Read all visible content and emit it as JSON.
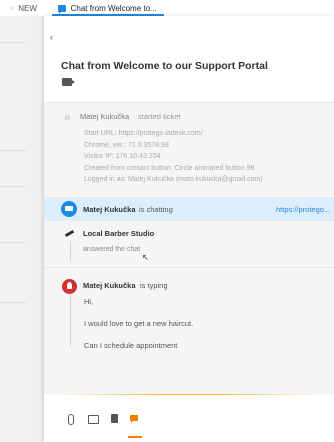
{
  "tabs": [
    {
      "label": "NEW"
    },
    {
      "label": "Chat from Welcome to..."
    }
  ],
  "panel": {
    "back_glyph": "‹",
    "title": "Chat from Welcome to our Support Portal"
  },
  "system_event": {
    "name": "Matej Kukučka",
    "action": "started ticket",
    "lines": [
      "Start URL: https://protego.ladesk.com/",
      "Chrome, ver.: 71.0.3578.98",
      "Visitor IP: 176.10.43.204",
      "Created from contact button: Circle animated button 98",
      "Logged in as: Matej Kukučka (mato.kukucka@gmail.com)"
    ]
  },
  "chatting_row": {
    "name": "Matej Kukučka",
    "status": "is chatting",
    "url": "https://protego..."
  },
  "agent_event": {
    "name": "Local Barber Studio",
    "text": "answered the chat"
  },
  "typing_event": {
    "name": "Matej Kukučka",
    "status": "is typing",
    "messages": [
      "Hi,",
      "I would love to get a new haircut.",
      "Can I schedule appointment"
    ]
  },
  "colors": {
    "accent": "#1e88e5",
    "highlight": "#dceefb",
    "avatar_red": "#d32f2f",
    "active_tool": "#f57c00"
  },
  "icons": {
    "tab_new": "circle-icon",
    "tab_chat": "chat-bubble-icon",
    "title": "label-icon",
    "system": "link-icon",
    "chatting": "chat-bubble-icon",
    "agent": "agent-icon",
    "user": "user-avatar-icon",
    "toolbar": [
      "attachment-icon",
      "comment-icon",
      "document-icon",
      "chat-icon"
    ]
  }
}
